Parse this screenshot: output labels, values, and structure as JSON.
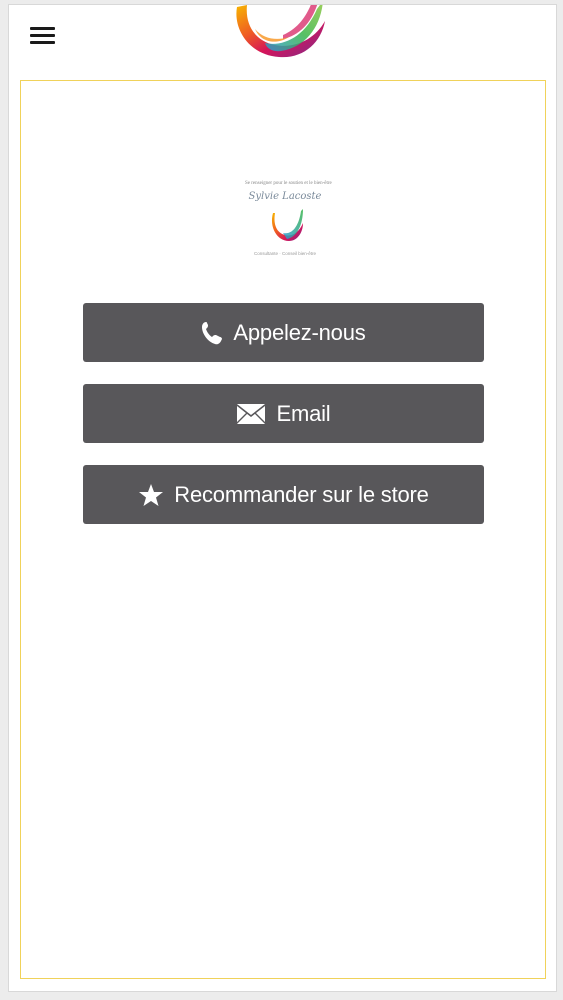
{
  "header": {
    "menu_icon": "hamburger-menu-icon",
    "logo_icon": "rainbow-swirl-logo"
  },
  "badge": {
    "tagline": "Se renseigner pour le soutien et le bien-être",
    "name": "Sylvie Lacoste",
    "subtitle": "Consultante · Conseil bien-être"
  },
  "actions": [
    {
      "label": "Appelez-nous",
      "icon": "phone-icon"
    },
    {
      "label": "Email",
      "icon": "envelope-icon"
    },
    {
      "label": "Recommander sur le store",
      "icon": "star-icon"
    }
  ],
  "colors": {
    "button_bg": "#58575a",
    "frame_border": "#f0d25a",
    "button_text": "#ffffff"
  }
}
